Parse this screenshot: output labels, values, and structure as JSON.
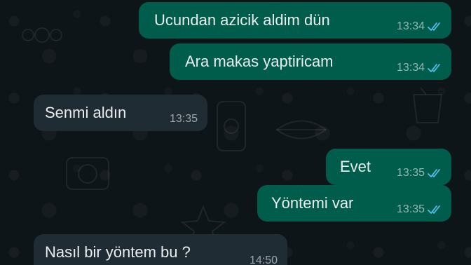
{
  "chat": {
    "messages": [
      {
        "direction": "outgoing",
        "text": "Ucundan azicik aldim dün",
        "time": "13:34",
        "status": "read"
      },
      {
        "direction": "outgoing",
        "text": "Ara makas yaptiricam",
        "time": "13:34",
        "status": "read"
      },
      {
        "direction": "incoming",
        "text": "Senmi aldın",
        "time": "13:35"
      },
      {
        "direction": "outgoing",
        "text": "Evet",
        "time": "13:35",
        "status": "read"
      },
      {
        "direction": "outgoing",
        "text": "Yöntemi var",
        "time": "13:35",
        "status": "read"
      },
      {
        "direction": "incoming",
        "text": "Nasıl bir yöntem bu ?",
        "time": "14:50"
      }
    ]
  },
  "colors": {
    "background": "#0c1317",
    "outgoing_bubble": "#005c4b",
    "incoming_bubble": "#202c33",
    "read_ticks": "#53bdeb",
    "text": "#e9edef"
  },
  "icons": {
    "read_receipt": "double-check-icon",
    "wallpaper": "doodle-pattern"
  }
}
